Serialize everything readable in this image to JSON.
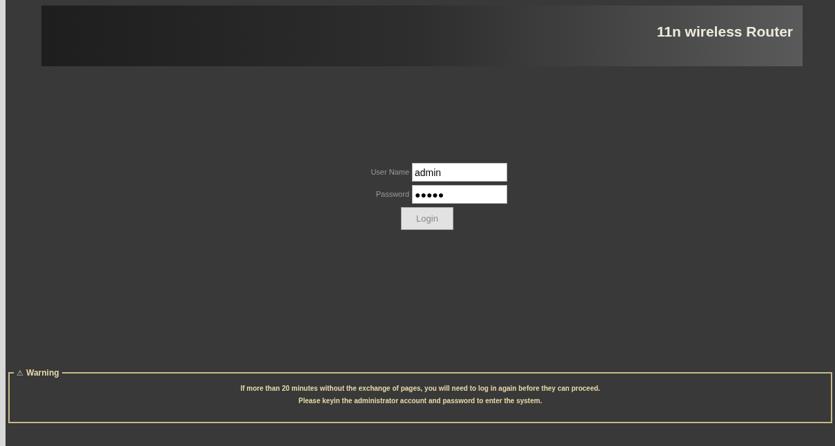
{
  "header": {
    "title": "11n wireless Router"
  },
  "login": {
    "fields": [
      {
        "label": "User Name",
        "value": "admin"
      },
      {
        "label": "Password",
        "value": "●●●●●"
      }
    ],
    "button": "Login"
  },
  "warning": {
    "title": "Warning",
    "icon": "⚠",
    "lines": [
      "If more than 20 minutes without the exchange of pages, you will need to log in again before they can proceed.",
      "Please keyin the administrator account and password to enter the system."
    ]
  }
}
